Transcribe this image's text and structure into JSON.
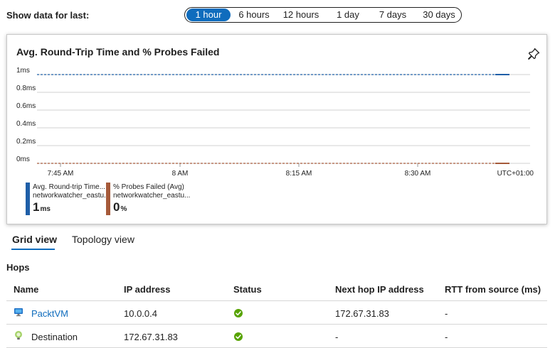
{
  "toolbar": {
    "label": "Show data for last:",
    "ranges": [
      "1 hour",
      "6 hours",
      "12 hours",
      "1 day",
      "7 days",
      "30 days"
    ],
    "active_range": "1 hour"
  },
  "chart_card": {
    "title": "Avg. Round-Trip Time and % Probes Failed",
    "pin_icon": "pin-icon"
  },
  "chart_data": {
    "type": "line",
    "title": "Avg. Round-Trip Time and % Probes Failed",
    "y_ticks": [
      "1ms",
      "0.8ms",
      "0.6ms",
      "0.4ms",
      "0.2ms",
      "0ms"
    ],
    "ylim": [
      0,
      1
    ],
    "x_ticks": [
      "7:45 AM",
      "8 AM",
      "8:15 AM",
      "8:30 AM"
    ],
    "timezone_label": "UTC+01:00",
    "grid": true,
    "series": [
      {
        "name": "Avg. Round-trip Time...",
        "color": "#1f5fa8",
        "values": [
          1,
          1
        ],
        "style": "dashed"
      },
      {
        "name": "% Probes Failed (Avg)",
        "color": "#a65a3a",
        "values": [
          0,
          0
        ],
        "style": "dashed"
      }
    ]
  },
  "legend": [
    {
      "name": "Avg. Round-trip Time...",
      "source": "networkwatcher_eastu...",
      "value": "1",
      "unit": "ms",
      "color": "#1f5fa8"
    },
    {
      "name": "% Probes Failed (Avg)",
      "source": "networkwatcher_eastu...",
      "value": "0",
      "unit": "%",
      "color": "#a65a3a"
    }
  ],
  "tabs": [
    {
      "label": "Grid view",
      "active": true
    },
    {
      "label": "Topology view",
      "active": false
    }
  ],
  "hops": {
    "title": "Hops",
    "columns": [
      "Name",
      "IP address",
      "Status",
      "Next hop IP address",
      "RTT from source (ms)"
    ],
    "rows": [
      {
        "name": "PacktVM",
        "icon": "vm-icon",
        "ip": "10.0.0.4",
        "status": "success",
        "next_hop": "172.67.31.83",
        "rtt": "-"
      },
      {
        "name": "Destination",
        "icon": "destination-icon",
        "ip": "172.67.31.83",
        "status": "success",
        "next_hop": "-",
        "rtt": "-"
      }
    ]
  }
}
